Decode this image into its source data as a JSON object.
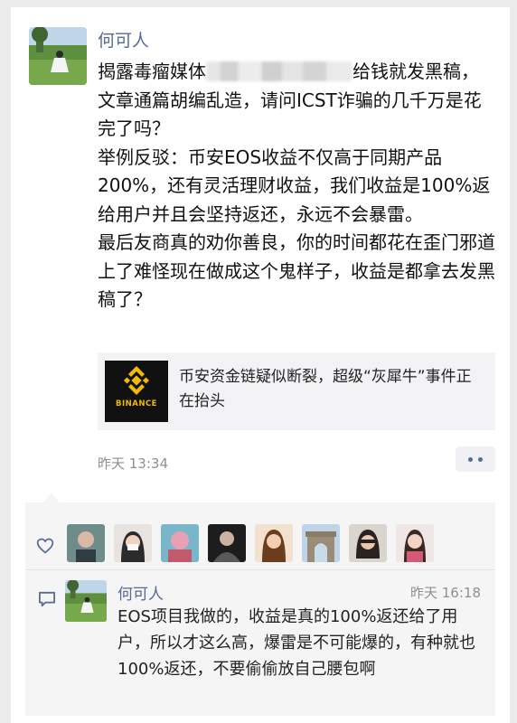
{
  "post": {
    "author": "何可人",
    "paragraphs": [
      {
        "before": "揭露毒瘤媒体",
        "after": "给钱就发黑稿，文章通篇胡编乱造，请问ICST诈骗的几千万是花完了吗？"
      },
      {
        "text": "举例反驳：币安EOS收益不仅高于同期产品200%，还有灵活理财收益，我们收益是100%返给用户并且会坚持返还，永远不会暴雷。"
      },
      {
        "text": "最后友商真的劝你善良，你的时间都花在歪门邪道上了难怪现在做成这个鬼样子，收益是都拿去发黑稿了？"
      }
    ],
    "link": {
      "title": "币安资金链疑似断裂，超级“灰犀牛”事件正在抬头",
      "thumb_label": "BINANCE",
      "brand_color": "#f0b90b"
    },
    "time": "昨天 13:34"
  },
  "likes": {
    "count": 8
  },
  "comment": {
    "author": "何可人",
    "time": "昨天 16:18",
    "text": "EOS项目我做的，收益是真的100%返还给了用户，所以才这么高，爆雷是不可能爆的，有种就也100%返还，不要偷偷放自己腰包啊"
  },
  "colors": {
    "name": "#576b95",
    "meta": "#8f8f8f",
    "comment_bg": "#f5f5f5"
  }
}
